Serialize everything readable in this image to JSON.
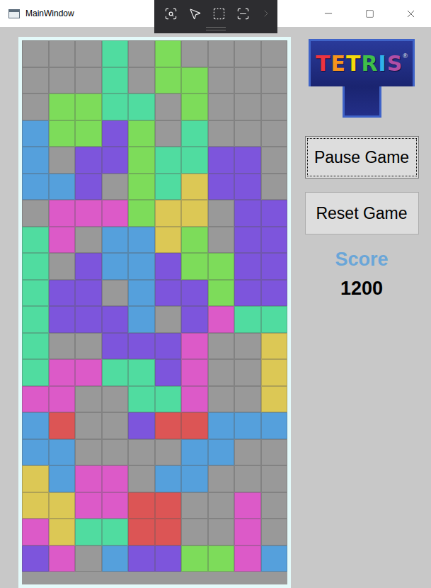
{
  "window": {
    "title": "MainWindow"
  },
  "board": {
    "rows": [
      [
        "#999999",
        "#999999",
        "#999999",
        "#50dca0",
        "#999999",
        "#7ddc5a",
        "#999999",
        "#999999",
        "#999999",
        "#999999"
      ],
      [
        "#999999",
        "#999999",
        "#999999",
        "#50dca0",
        "#999999",
        "#7ddc5a",
        "#7ddc5a",
        "#999999",
        "#999999",
        "#999999"
      ],
      [
        "#999999",
        "#7ddc5a",
        "#7ddc5a",
        "#50dca0",
        "#50dca0",
        "#999999",
        "#7ddc5a",
        "#999999",
        "#999999",
        "#999999"
      ],
      [
        "#55a0dc",
        "#7ddc5a",
        "#7ddc5a",
        "#7d55dc",
        "#7ddc5a",
        "#999999",
        "#50dca0",
        "#999999",
        "#999999",
        "#999999"
      ],
      [
        "#55a0dc",
        "#999999",
        "#7d55dc",
        "#7d55dc",
        "#7ddc5a",
        "#50dca0",
        "#50dca0",
        "#7d55dc",
        "#7d55dc",
        "#999999"
      ],
      [
        "#55a0dc",
        "#55a0dc",
        "#7d55dc",
        "#999999",
        "#7ddc5a",
        "#50dca0",
        "#dcc855",
        "#7d55dc",
        "#7d55dc",
        "#999999"
      ],
      [
        "#999999",
        "#dc5ac8",
        "#dc5ac8",
        "#dc5ac8",
        "#7ddc5a",
        "#dcc855",
        "#dcc855",
        "#999999",
        "#7d55dc",
        "#7d55dc"
      ],
      [
        "#50dca0",
        "#dc5ac8",
        "#999999",
        "#55a0dc",
        "#55a0dc",
        "#dcc855",
        "#7ddc5a",
        "#999999",
        "#7d55dc",
        "#7d55dc"
      ],
      [
        "#50dca0",
        "#999999",
        "#7d55dc",
        "#55a0dc",
        "#55a0dc",
        "#7d55dc",
        "#7ddc5a",
        "#7ddc5a",
        "#7d55dc",
        "#7d55dc"
      ],
      [
        "#50dca0",
        "#7d55dc",
        "#7d55dc",
        "#999999",
        "#55a0dc",
        "#7d55dc",
        "#7d55dc",
        "#7ddc5a",
        "#7d55dc",
        "#7d55dc"
      ],
      [
        "#50dca0",
        "#7d55dc",
        "#7d55dc",
        "#7d55dc",
        "#55a0dc",
        "#999999",
        "#7d55dc",
        "#dc5ac8",
        "#50dca0",
        "#50dca0"
      ],
      [
        "#50dca0",
        "#999999",
        "#999999",
        "#7d55dc",
        "#7d55dc",
        "#7d55dc",
        "#dc5ac8",
        "#999999",
        "#999999",
        "#dcc855"
      ],
      [
        "#50dca0",
        "#dc5ac8",
        "#dc5ac8",
        "#50dca0",
        "#50dca0",
        "#7d55dc",
        "#dc5ac8",
        "#999999",
        "#999999",
        "#dcc855"
      ],
      [
        "#dc5ac8",
        "#dc5ac8",
        "#999999",
        "#999999",
        "#50dca0",
        "#50dca0",
        "#dc5ac8",
        "#999999",
        "#999999",
        "#dcc855"
      ],
      [
        "#55a0dc",
        "#dc5555",
        "#999999",
        "#999999",
        "#7d55dc",
        "#dc5555",
        "#dc5555",
        "#55a0dc",
        "#55a0dc",
        "#55a0dc"
      ],
      [
        "#55a0dc",
        "#55a0dc",
        "#999999",
        "#999999",
        "#999999",
        "#999999",
        "#55a0dc",
        "#55a0dc",
        "#999999",
        "#999999"
      ],
      [
        "#dcc855",
        "#55a0dc",
        "#dc5ac8",
        "#dc5ac8",
        "#999999",
        "#55a0dc",
        "#55a0dc",
        "#999999",
        "#999999",
        "#999999"
      ],
      [
        "#dcc855",
        "#dcc855",
        "#dc5ac8",
        "#dc5ac8",
        "#dc5555",
        "#dc5555",
        "#999999",
        "#999999",
        "#dc5ac8",
        "#999999"
      ],
      [
        "#dc5ac8",
        "#dcc855",
        "#50dca0",
        "#50dca0",
        "#dc5555",
        "#dc5555",
        "#999999",
        "#999999",
        "#dc5ac8",
        "#999999"
      ],
      [
        "#7d55dc",
        "#dc5ac8",
        "#999999",
        "#55a0dc",
        "#7d55dc",
        "#7d55dc",
        "#7ddc5a",
        "#7ddc5a",
        "#dc5ac8",
        "#55a0dc"
      ]
    ]
  },
  "logo": {
    "text": "TETRIS",
    "mark": "®",
    "letter_colors": [
      "#ee3340",
      "#f7941d",
      "#f5d90a",
      "#3fbf4a",
      "#2fb3ea",
      "#b04ea6"
    ]
  },
  "buttons": [
    {
      "label": "Pause Game",
      "focused": true
    },
    {
      "label": "Reset Game",
      "focused": false
    }
  ],
  "score": {
    "label": "Score",
    "value": "1200"
  }
}
